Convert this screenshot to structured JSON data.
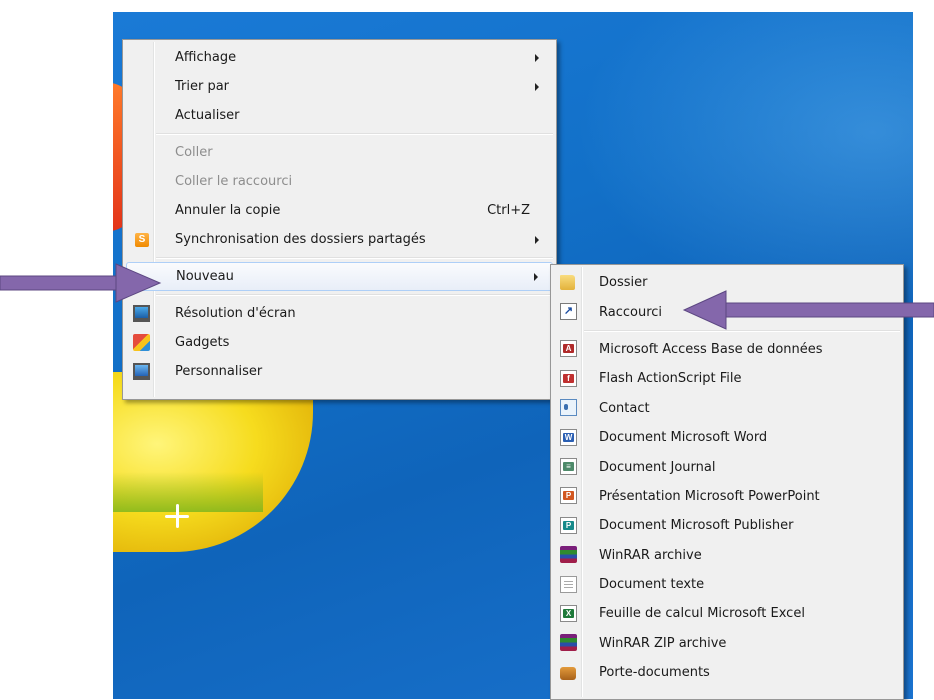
{
  "main_menu": {
    "items": [
      {
        "label": "Affichage",
        "shortcut": "",
        "submenu": true,
        "disabled": false,
        "icon": ""
      },
      {
        "label": "Trier par",
        "shortcut": "",
        "submenu": true,
        "disabled": false,
        "icon": ""
      },
      {
        "label": "Actualiser",
        "shortcut": "",
        "submenu": false,
        "disabled": false,
        "icon": ""
      },
      {
        "label": "Coller",
        "shortcut": "",
        "submenu": false,
        "disabled": true,
        "icon": ""
      },
      {
        "label": "Coller le raccourci",
        "shortcut": "",
        "submenu": false,
        "disabled": true,
        "icon": ""
      },
      {
        "label": "Annuler la copie",
        "shortcut": "Ctrl+Z",
        "submenu": false,
        "disabled": false,
        "icon": ""
      },
      {
        "label": "Synchronisation des dossiers partagés",
        "shortcut": "",
        "submenu": true,
        "disabled": false,
        "icon": "sync-icon"
      },
      {
        "label": "Nouveau",
        "shortcut": "",
        "submenu": true,
        "disabled": false,
        "icon": ""
      },
      {
        "label": "Résolution d'écran",
        "shortcut": "",
        "submenu": false,
        "disabled": false,
        "icon": "screen-resolution-icon"
      },
      {
        "label": "Gadgets",
        "shortcut": "",
        "submenu": false,
        "disabled": false,
        "icon": "gadgets-icon"
      },
      {
        "label": "Personnaliser",
        "shortcut": "",
        "submenu": false,
        "disabled": false,
        "icon": "personalize-icon"
      }
    ]
  },
  "new_submenu": {
    "items": [
      {
        "label": "Dossier",
        "icon": "folder-icon"
      },
      {
        "label": "Raccourci",
        "icon": "shortcut-icon"
      },
      {
        "label": "Microsoft Access Base de données",
        "icon": "access-icon"
      },
      {
        "label": "Flash ActionScript File",
        "icon": "flash-icon"
      },
      {
        "label": "Contact",
        "icon": "contact-icon"
      },
      {
        "label": "Document Microsoft Word",
        "icon": "word-icon"
      },
      {
        "label": "Document Journal",
        "icon": "journal-icon"
      },
      {
        "label": "Présentation Microsoft PowerPoint",
        "icon": "powerpoint-icon"
      },
      {
        "label": "Document Microsoft Publisher",
        "icon": "publisher-icon"
      },
      {
        "label": "WinRAR archive",
        "icon": "winrar-icon"
      },
      {
        "label": "Document texte",
        "icon": "text-document-icon"
      },
      {
        "label": "Feuille de calcul Microsoft Excel",
        "icon": "excel-icon"
      },
      {
        "label": "WinRAR ZIP archive",
        "icon": "winrar-zip-icon"
      },
      {
        "label": "Porte-documents",
        "icon": "briefcase-icon"
      }
    ]
  },
  "icon_glyphs": {
    "sync": "S",
    "shortcut": "↗",
    "access": "A",
    "flash": "f",
    "word": "W",
    "journal": "≡",
    "powerpoint": "P",
    "publisher": "P",
    "excel": "X"
  },
  "colors": {
    "desktop_blue": "#1270c8",
    "menu_bg": "#f0f0f0",
    "hover_border": "#aecff7",
    "annotation_arrow": "#8467ab"
  }
}
